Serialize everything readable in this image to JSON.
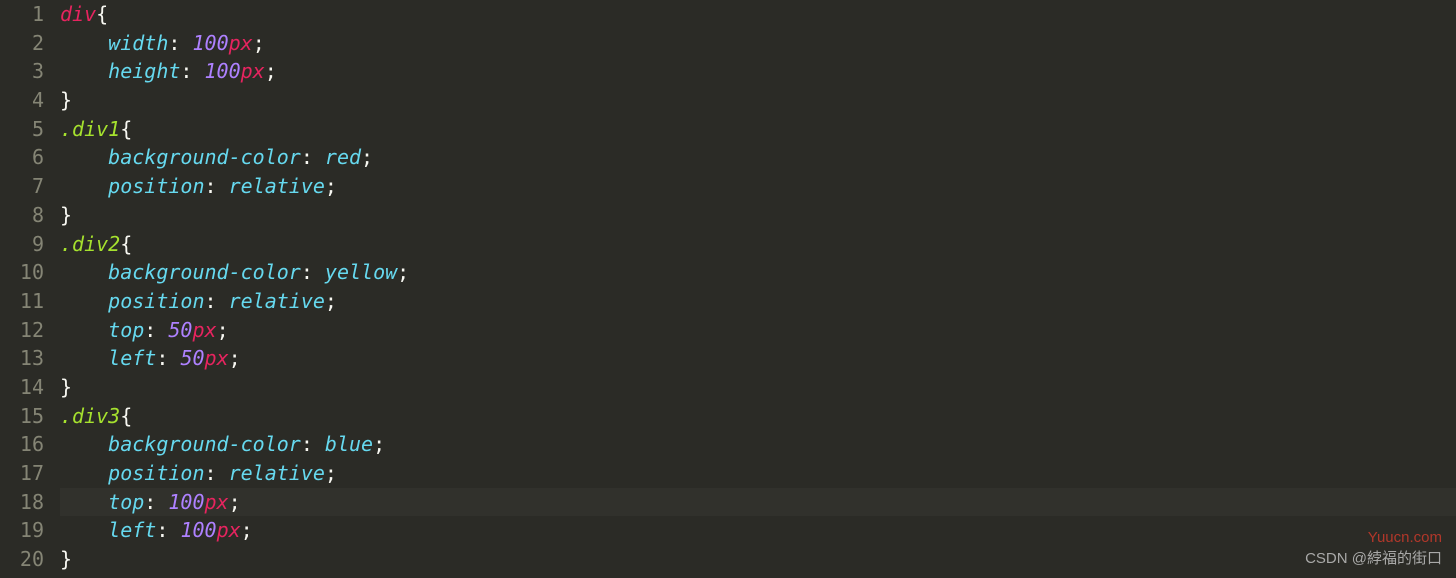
{
  "lineNumbers": [
    "1",
    "2",
    "3",
    "4",
    "5",
    "6",
    "7",
    "8",
    "9",
    "10",
    "11",
    "12",
    "13",
    "14",
    "15",
    "16",
    "17",
    "18",
    "19",
    "20"
  ],
  "activeLine": 18,
  "code": [
    [
      {
        "t": "div",
        "c": "sel"
      },
      {
        "t": "{",
        "c": "plain"
      }
    ],
    [
      {
        "t": "    ",
        "c": "plain"
      },
      {
        "t": "width",
        "c": "prop"
      },
      {
        "t": ": ",
        "c": "plain"
      },
      {
        "t": "100",
        "c": "num"
      },
      {
        "t": "px",
        "c": "unit"
      },
      {
        "t": ";",
        "c": "plain"
      }
    ],
    [
      {
        "t": "    ",
        "c": "plain"
      },
      {
        "t": "height",
        "c": "prop"
      },
      {
        "t": ": ",
        "c": "plain"
      },
      {
        "t": "100",
        "c": "num"
      },
      {
        "t": "px",
        "c": "unit"
      },
      {
        "t": ";",
        "c": "plain"
      }
    ],
    [
      {
        "t": "}",
        "c": "plain"
      }
    ],
    [
      {
        "t": ".div1",
        "c": "cls"
      },
      {
        "t": "{",
        "c": "plain"
      }
    ],
    [
      {
        "t": "    ",
        "c": "plain"
      },
      {
        "t": "background-color",
        "c": "prop"
      },
      {
        "t": ": ",
        "c": "plain"
      },
      {
        "t": "red",
        "c": "val"
      },
      {
        "t": ";",
        "c": "plain"
      }
    ],
    [
      {
        "t": "    ",
        "c": "plain"
      },
      {
        "t": "position",
        "c": "prop"
      },
      {
        "t": ": ",
        "c": "plain"
      },
      {
        "t": "relative",
        "c": "val"
      },
      {
        "t": ";",
        "c": "plain"
      }
    ],
    [
      {
        "t": "}",
        "c": "plain"
      }
    ],
    [
      {
        "t": ".div2",
        "c": "cls"
      },
      {
        "t": "{",
        "c": "plain"
      }
    ],
    [
      {
        "t": "    ",
        "c": "plain"
      },
      {
        "t": "background-color",
        "c": "prop"
      },
      {
        "t": ": ",
        "c": "plain"
      },
      {
        "t": "yellow",
        "c": "val"
      },
      {
        "t": ";",
        "c": "plain"
      }
    ],
    [
      {
        "t": "    ",
        "c": "plain"
      },
      {
        "t": "position",
        "c": "prop"
      },
      {
        "t": ": ",
        "c": "plain"
      },
      {
        "t": "relative",
        "c": "val"
      },
      {
        "t": ";",
        "c": "plain"
      }
    ],
    [
      {
        "t": "    ",
        "c": "plain"
      },
      {
        "t": "top",
        "c": "prop"
      },
      {
        "t": ": ",
        "c": "plain"
      },
      {
        "t": "50",
        "c": "num"
      },
      {
        "t": "px",
        "c": "unit"
      },
      {
        "t": ";",
        "c": "plain"
      }
    ],
    [
      {
        "t": "    ",
        "c": "plain"
      },
      {
        "t": "left",
        "c": "prop"
      },
      {
        "t": ": ",
        "c": "plain"
      },
      {
        "t": "50",
        "c": "num"
      },
      {
        "t": "px",
        "c": "unit"
      },
      {
        "t": ";",
        "c": "plain"
      }
    ],
    [
      {
        "t": "}",
        "c": "plain"
      }
    ],
    [
      {
        "t": ".div3",
        "c": "cls"
      },
      {
        "t": "{",
        "c": "plain"
      }
    ],
    [
      {
        "t": "    ",
        "c": "plain"
      },
      {
        "t": "background-color",
        "c": "prop"
      },
      {
        "t": ": ",
        "c": "plain"
      },
      {
        "t": "blue",
        "c": "val"
      },
      {
        "t": ";",
        "c": "plain"
      }
    ],
    [
      {
        "t": "    ",
        "c": "plain"
      },
      {
        "t": "position",
        "c": "prop"
      },
      {
        "t": ": ",
        "c": "plain"
      },
      {
        "t": "relative",
        "c": "val"
      },
      {
        "t": ";",
        "c": "plain"
      }
    ],
    [
      {
        "t": "    ",
        "c": "plain"
      },
      {
        "t": "top",
        "c": "prop"
      },
      {
        "t": ": ",
        "c": "plain"
      },
      {
        "t": "100",
        "c": "num"
      },
      {
        "t": "px",
        "c": "unit"
      },
      {
        "t": ";",
        "c": "plain"
      }
    ],
    [
      {
        "t": "    ",
        "c": "plain"
      },
      {
        "t": "left",
        "c": "prop"
      },
      {
        "t": ": ",
        "c": "plain"
      },
      {
        "t": "100",
        "c": "num"
      },
      {
        "t": "px",
        "c": "unit"
      },
      {
        "t": ";",
        "c": "plain"
      }
    ],
    [
      {
        "t": "}",
        "c": "plain"
      }
    ]
  ],
  "watermark1": "Yuucn.com",
  "watermark2": "CSDN @綍福的街口"
}
